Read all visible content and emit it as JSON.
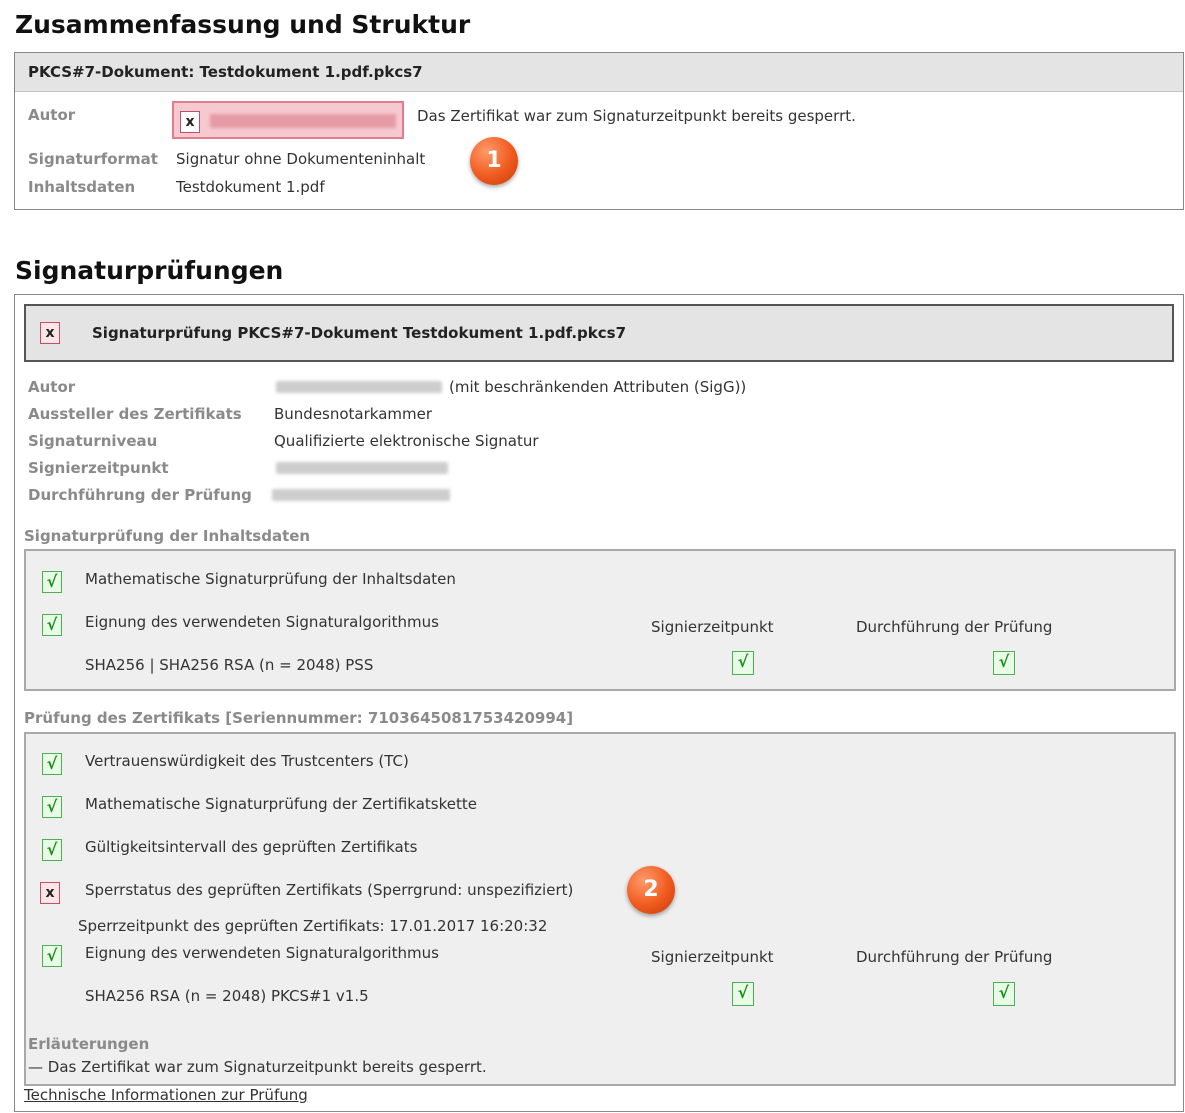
{
  "summary": {
    "heading": "Zusammenfassung und Struktur",
    "doc_header": "PKCS#7-Dokument: Testdokument 1.pdf.pkcs7",
    "autor_label": "Autor",
    "status_text": "Das Zertifikat war zum Signaturzeitpunkt bereits gesperrt.",
    "format_label": "Signaturformat",
    "format_value": "Signatur ohne Dokumenteninhalt",
    "content_label": "Inhaltsdaten",
    "content_value": "Testdokument 1.pdf",
    "badge": "1"
  },
  "checks": {
    "heading": "Signaturprüfungen",
    "header_title": "Signaturprüfung PKCS#7-Dokument Testdokument 1.pdf.pkcs7",
    "fields": {
      "autor_label": "Autor",
      "autor_suffix": "(mit beschränkenden Attributen (SigG))",
      "issuer_label": "Aussteller des Zertifikats",
      "issuer_value": "Bundesnotarkammer",
      "level_label": "Signaturniveau",
      "level_value": "Qualifizierte elektronische Signatur",
      "signtime_label": "Signierzeitpunkt",
      "verify_label": "Durchführung der Prüfung"
    },
    "content_section": {
      "title": "Signaturprüfung der Inhaltsdaten",
      "item1": "Mathematische Signaturprüfung der Inhaltsdaten",
      "item2": "Eignung des verwendeten Signaturalgorithmus",
      "algo": "SHA256 | SHA256 RSA (n = 2048) PSS",
      "col1": "Signierzeitpunkt",
      "col2": "Durchführung der Prüfung"
    },
    "cert_section": {
      "title": "Prüfung des Zertifikats [Seriennummer: 7103645081753420994]",
      "item1": "Vertrauenswürdigkeit des Trustcenters (TC)",
      "item2": "Mathematische Signaturprüfung der Zertifikatskette",
      "item3": "Gültigkeitsintervall des geprüften Zertifikats",
      "item4": "Sperrstatus des geprüften Zertifikats (Sperrgrund: unspezifiziert)",
      "revoke_time": "Sperrzeitpunkt des geprüften Zertifikats: 17.01.2017 16:20:32",
      "item5": "Eignung des verwendeten Signaturalgorithmus",
      "algo": "SHA256 RSA (n = 2048) PKCS#1 v1.5",
      "col1": "Signierzeitpunkt",
      "col2": "Durchführung der Prüfung",
      "badge": "2"
    },
    "notes": {
      "title": "Erläuterungen",
      "text": "— Das Zertifikat war zum Signaturzeitpunkt bereits gesperrt."
    },
    "tech_link": "Technische Informationen zur Prüfung"
  },
  "icons": {
    "check": "√",
    "cross": "x"
  },
  "colors": {
    "ok": "#4caf50",
    "fail": "#c0506a",
    "badge": "#f05a1e"
  }
}
